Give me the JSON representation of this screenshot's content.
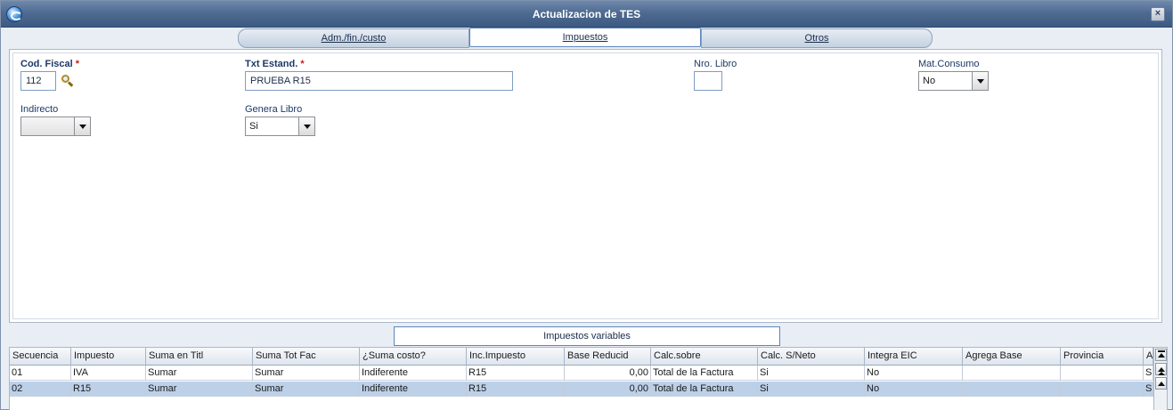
{
  "window": {
    "title": "Actualizacion de TES",
    "close_label": "×"
  },
  "tabs": [
    {
      "label": "Adm./fin./custo",
      "active": false
    },
    {
      "label": "Impuestos",
      "active": true
    },
    {
      "label": "Otros",
      "active": false
    }
  ],
  "form": {
    "cod_fiscal": {
      "label": "Cod. Fiscal",
      "required_mark": "*",
      "value": "112"
    },
    "txt_estand": {
      "label": "Txt Estand.",
      "required_mark": "*",
      "value": "PRUEBA R15"
    },
    "nro_libro": {
      "label": "Nro. Libro",
      "value": ""
    },
    "mat_consumo": {
      "label": "Mat.Consumo",
      "value": "No"
    },
    "indirecto": {
      "label": "Indirecto",
      "value": ""
    },
    "genera_libro": {
      "label": "Genera Libro",
      "value": "Si"
    }
  },
  "subtab": {
    "label": "Impuestos variables"
  },
  "grid": {
    "columns": [
      "Secuencia",
      "Impuesto",
      "Suma en Titl",
      "Suma Tot Fac",
      "¿Suma costo?",
      "Inc.Impuesto",
      "Base Reducid",
      "Calc.sobre",
      "Calc. S/Neto",
      "Integra EIC",
      "Agrega Base",
      "Provincia",
      "A"
    ],
    "rows": [
      [
        "01",
        "IVA",
        "Sumar",
        "Sumar",
        "Indiferente",
        "R15",
        "0,00",
        "Total de la Factura",
        "Si",
        "No",
        "",
        "",
        "S"
      ],
      [
        "02",
        "R15",
        "Sumar",
        "Sumar",
        "Indiferente",
        "R15",
        "0,00",
        "Total de la Factura",
        "Si",
        "No",
        "",
        "",
        "S"
      ]
    ],
    "selected_row": 1
  },
  "colors": {
    "title_bar": "#4f6b91",
    "selected_row": "#bcd0e8",
    "required": "#d11a1a"
  }
}
